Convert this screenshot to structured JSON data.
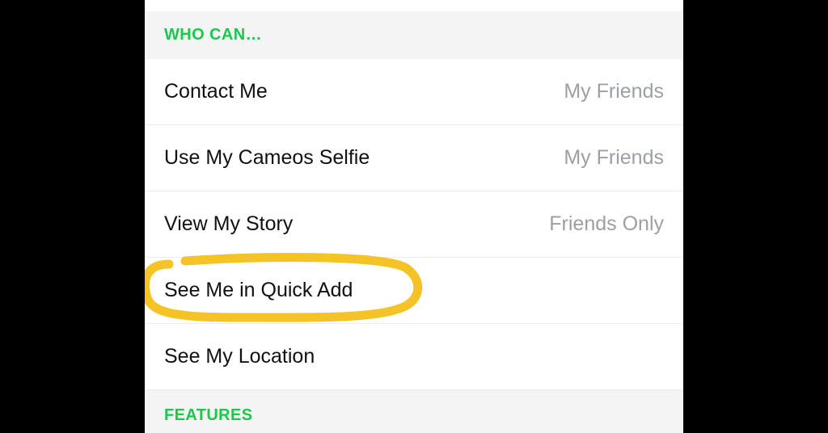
{
  "sections": {
    "who_can": {
      "title": "WHO CAN…",
      "rows": [
        {
          "label": "Contact Me",
          "value": "My Friends"
        },
        {
          "label": "Use My Cameos Selfie",
          "value": "My Friends"
        },
        {
          "label": "View My Story",
          "value": "Friends Only"
        },
        {
          "label": "See Me in Quick Add",
          "value": ""
        },
        {
          "label": "See My Location",
          "value": ""
        }
      ]
    },
    "features": {
      "title": "FEATURES"
    }
  },
  "annotation": {
    "highlighted_row_index": 3,
    "color": "#f4c427"
  }
}
